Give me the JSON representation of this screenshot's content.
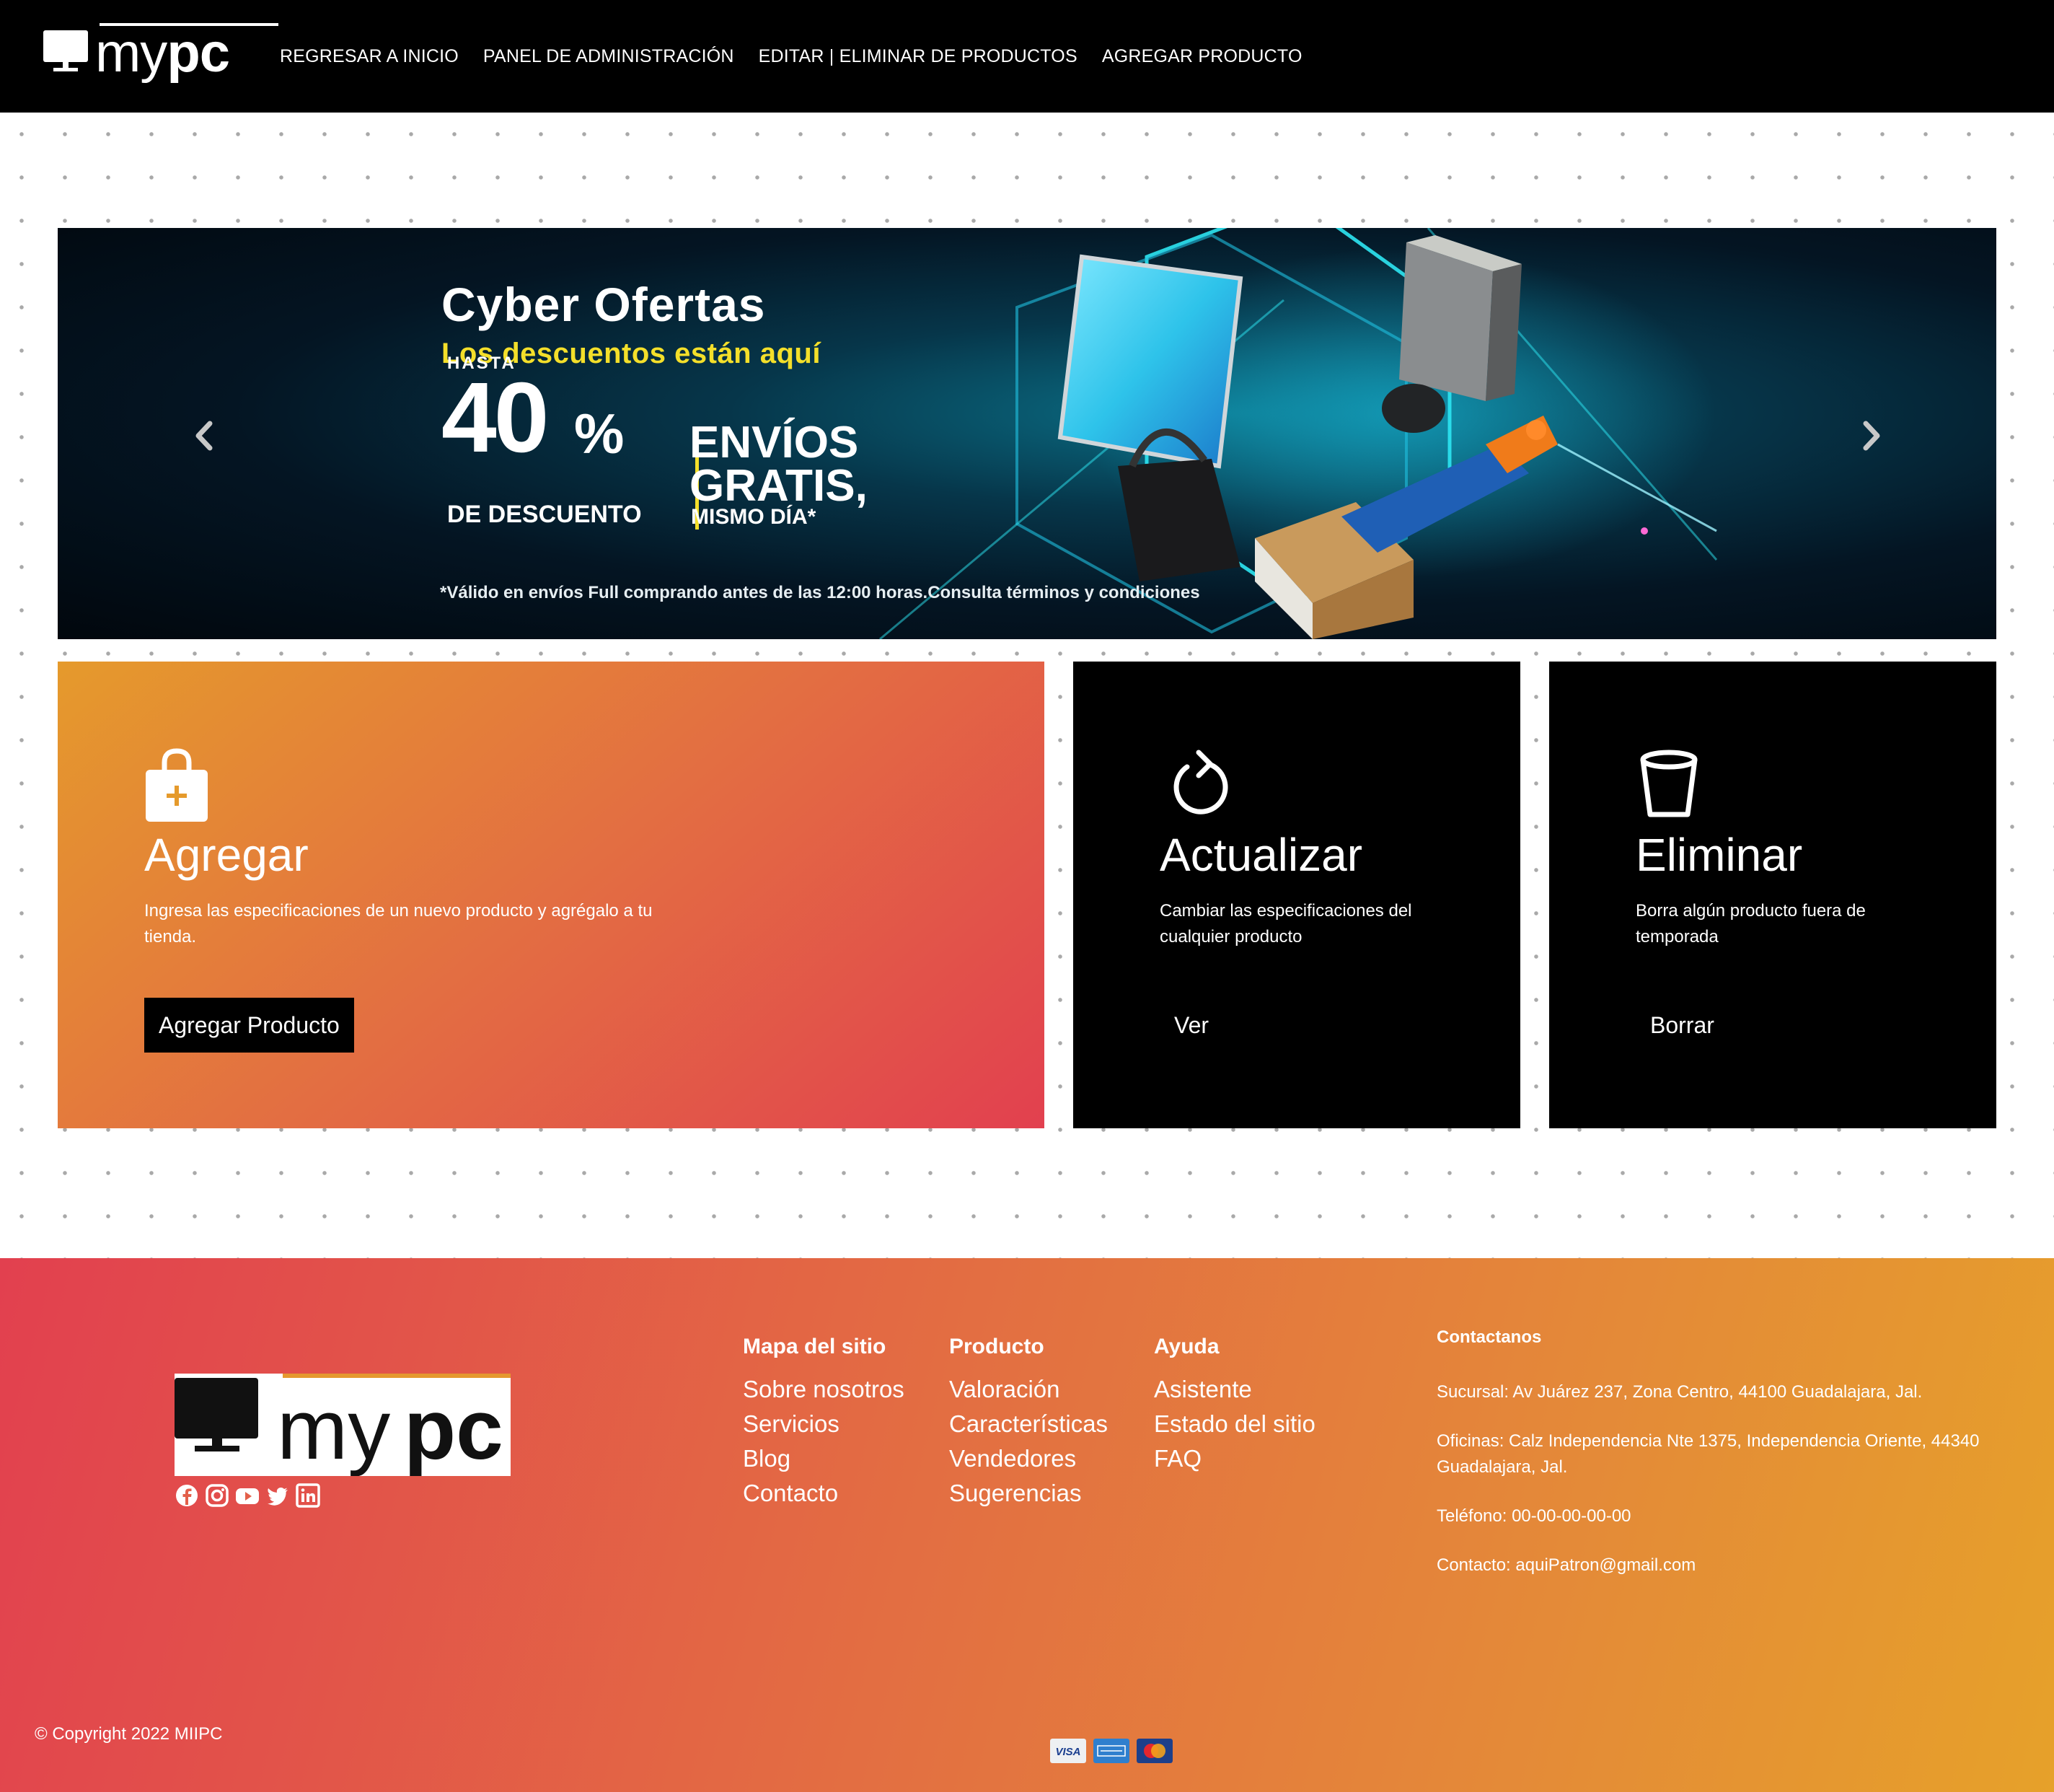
{
  "nav": {
    "brand_light": "my",
    "brand_bold": "pc",
    "links": [
      "REGRESAR A INICIO",
      "PANEL DE ADMINISTRACIÓN",
      "EDITAR | ELIMINAR DE PRODUCTOS",
      "AGREGAR PRODUCTO"
    ]
  },
  "banner": {
    "title": "Cyber Ofertas",
    "subtitle": "Los descuentos están aquí",
    "hasta": "HASTA",
    "discount_number": "40",
    "discount_symbol": "%",
    "discount_label": "DE DESCUENTO",
    "shipping_line1": "ENVÍOS",
    "shipping_line2": "GRATIS,",
    "shipping_line3": "MISMO DÍA*",
    "disclaimer": "*Válido en envíos Full comprando antes de las 12:00 horas.Consulta términos y condiciones",
    "prev_icon": "chevron-left-icon",
    "next_icon": "chevron-right-icon"
  },
  "cards": {
    "agregar": {
      "icon": "shopping-bag-plus-icon",
      "title": "Agregar",
      "text": "Ingresa las especificaciones de un nuevo producto y agrégalo a tu tienda.",
      "button": "Agregar Producto"
    },
    "actualizar": {
      "icon": "refresh-icon",
      "title": "Actualizar",
      "text": "Cambiar las especificaciones del cualquier producto",
      "button": "Ver"
    },
    "eliminar": {
      "icon": "trash-cup-icon",
      "title": "Eliminar",
      "text": "Borra algún producto fuera de temporada",
      "button": "Borrar"
    }
  },
  "footer": {
    "brand_light": "my",
    "brand_bold": "pc",
    "social_icons": [
      "facebook-icon",
      "instagram-icon",
      "youtube-icon",
      "twitter-icon",
      "linkedin-icon"
    ],
    "columns": [
      {
        "title": "Mapa del sitio",
        "links": [
          "Sobre nosotros",
          "Servicios",
          "Blog",
          "Contacto"
        ]
      },
      {
        "title": "Producto",
        "links": [
          "Valoración",
          "Características",
          "Vendedores",
          "Sugerencias"
        ]
      },
      {
        "title": "Ayuda",
        "links": [
          "Asistente",
          "Estado del sitio",
          "FAQ"
        ]
      }
    ],
    "contact": {
      "title": "Contactanos",
      "sucursal": "Sucursal: Av Juárez 237, Zona Centro, 44100 Guadalajara, Jal.",
      "oficinas": "Oficinas: Calz Independencia Nte 1375, Independencia Oriente, 44340 Guadalajara, Jal.",
      "telefono": "Teléfono: 00-00-00-00-00",
      "email": "Contacto: aquiPatron@gmail.com"
    },
    "copyright": "© Copyright 2022 MIIPC",
    "payment_icons": [
      "visa-icon",
      "american-express-icon",
      "mastercard-icon"
    ],
    "visa_text": "VISA"
  },
  "colors": {
    "nav_bg": "#000000",
    "accent_orange": "#e59a2c",
    "accent_red": "#e2404f",
    "banner_yellow": "#f4df2a",
    "card_dark": "#000000"
  }
}
